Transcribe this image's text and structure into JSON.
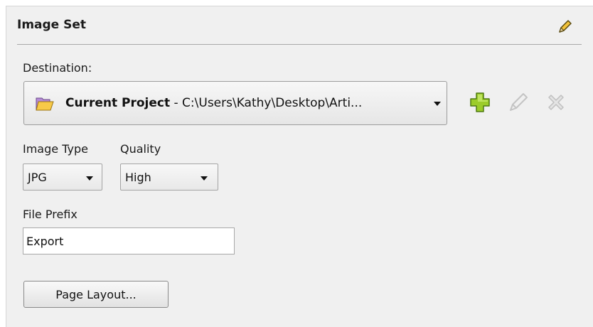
{
  "panel": {
    "title": "Image Set",
    "edit_icon": "pencil-icon"
  },
  "destination": {
    "label": "Destination:",
    "icon": "folder-icon",
    "project_name": "Current Project",
    "path": " - C:\\Users\\Kathy\\Desktop\\Arti...",
    "actions": {
      "add_icon": "plus-icon",
      "edit_icon": "pencil-icon",
      "delete_icon": "x-icon"
    }
  },
  "image_type": {
    "label": "Image Type",
    "value": "JPG"
  },
  "quality": {
    "label": "Quality",
    "value": "High"
  },
  "file_prefix": {
    "label": "File Prefix",
    "value": "Export"
  },
  "page_layout_button": {
    "label": "Page Layout..."
  },
  "colors": {
    "panel_bg": "#f0f0f0",
    "add_green": "#8ec21f",
    "disabled_gray": "#c4c4c4"
  }
}
